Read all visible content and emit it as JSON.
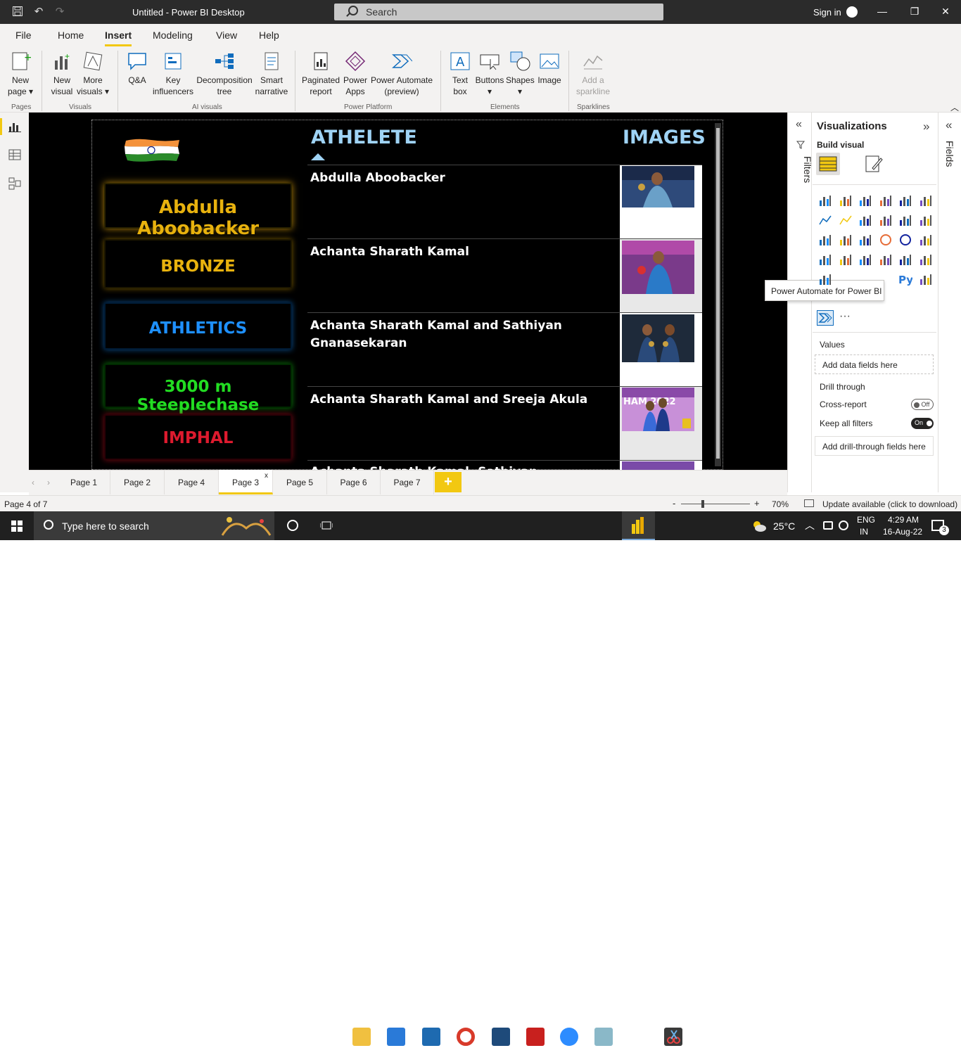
{
  "titlebar": {
    "title": "Untitled - Power BI Desktop",
    "search_placeholder": "Search",
    "signin": "Sign in"
  },
  "menu": {
    "items": [
      "File",
      "Home",
      "Insert",
      "Modeling",
      "View",
      "Help"
    ]
  },
  "ribbon": {
    "pages": {
      "new_page": "New",
      "new_page2": "page",
      "group": "Pages"
    },
    "visuals": {
      "new_visual_1": "New",
      "new_visual_2": "visual",
      "more_visuals_1": "More",
      "more_visuals_2": "visuals",
      "group": "Visuals"
    },
    "ai": {
      "qa": "Q&A",
      "key_1": "Key",
      "key_2": "influencers",
      "decomp_1": "Decomposition",
      "decomp_2": "tree",
      "smart_1": "Smart",
      "smart_2": "narrative",
      "group": "AI visuals"
    },
    "platform": {
      "paginated_1": "Paginated",
      "paginated_2": "report",
      "apps_1": "Power",
      "apps_2": "Apps",
      "automate_1": "Power Automate",
      "automate_2": "(preview)",
      "group": "Power Platform"
    },
    "elements": {
      "text_1": "Text",
      "text_2": "box",
      "buttons": "Buttons",
      "shapes": "Shapes",
      "image": "Image",
      "group": "Elements"
    },
    "sparklines": {
      "add_1": "Add a",
      "add_2": "sparkline",
      "group": "Sparklines"
    }
  },
  "report": {
    "cards": [
      {
        "text": "Abdulla Aboobacker",
        "color": "#e8b20e"
      },
      {
        "text": "BRONZE",
        "color": "#e8b20e"
      },
      {
        "text": "ATHLETICS",
        "color": "#1e90ff"
      },
      {
        "text": "3000 m Steeplechase",
        "color": "#22dd22"
      },
      {
        "text": "IMPHAL",
        "color": "#dd1a2e"
      }
    ],
    "table": {
      "col_athlete": "ATHELETE",
      "col_images": "IMAGES",
      "rows": [
        {
          "name": "Abdulla Aboobacker"
        },
        {
          "name": "Achanta Sharath Kamal"
        },
        {
          "name": "Achanta Sharath Kamal and Sathiyan Gnanasekaran"
        },
        {
          "name": "Achanta Sharath Kamal and Sreeja Akula"
        },
        {
          "name": "Achanta Sharath Kamal, Sathiyan Gnanasekaran"
        }
      ],
      "image_text_row4": "HAM 2022"
    }
  },
  "filters": {
    "label": "Filters"
  },
  "visualizations": {
    "title": "Visualizations",
    "build_visual": "Build visual",
    "tooltip": "Power Automate for Power BI",
    "more": "···",
    "values": "Values",
    "add_data": "Add data fields here",
    "drill_through": "Drill through",
    "cross_report": "Cross-report",
    "cross_report_state": "Off",
    "keep_filters": "Keep all filters",
    "keep_filters_state": "On",
    "add_drill": "Add drill-through fields here"
  },
  "fields": {
    "label": "Fields"
  },
  "pages": {
    "tabs": [
      "Page 1",
      "Page 2",
      "Page 4",
      "Page 3",
      "Page 5",
      "Page 6",
      "Page 7"
    ],
    "active": "Page 3",
    "add": "+"
  },
  "status": {
    "page_indicator": "Page 4 of 7",
    "zoom": "70%",
    "zoom_minus": "-",
    "zoom_plus": "+",
    "update": "Update available (click to download)"
  },
  "taskbar": {
    "search": "Type here to search",
    "temperature": "25°C",
    "lang_1": "ENG",
    "lang_2": "IN",
    "time": "4:29 AM",
    "date": "16-Aug-22",
    "notif_count": "3"
  }
}
